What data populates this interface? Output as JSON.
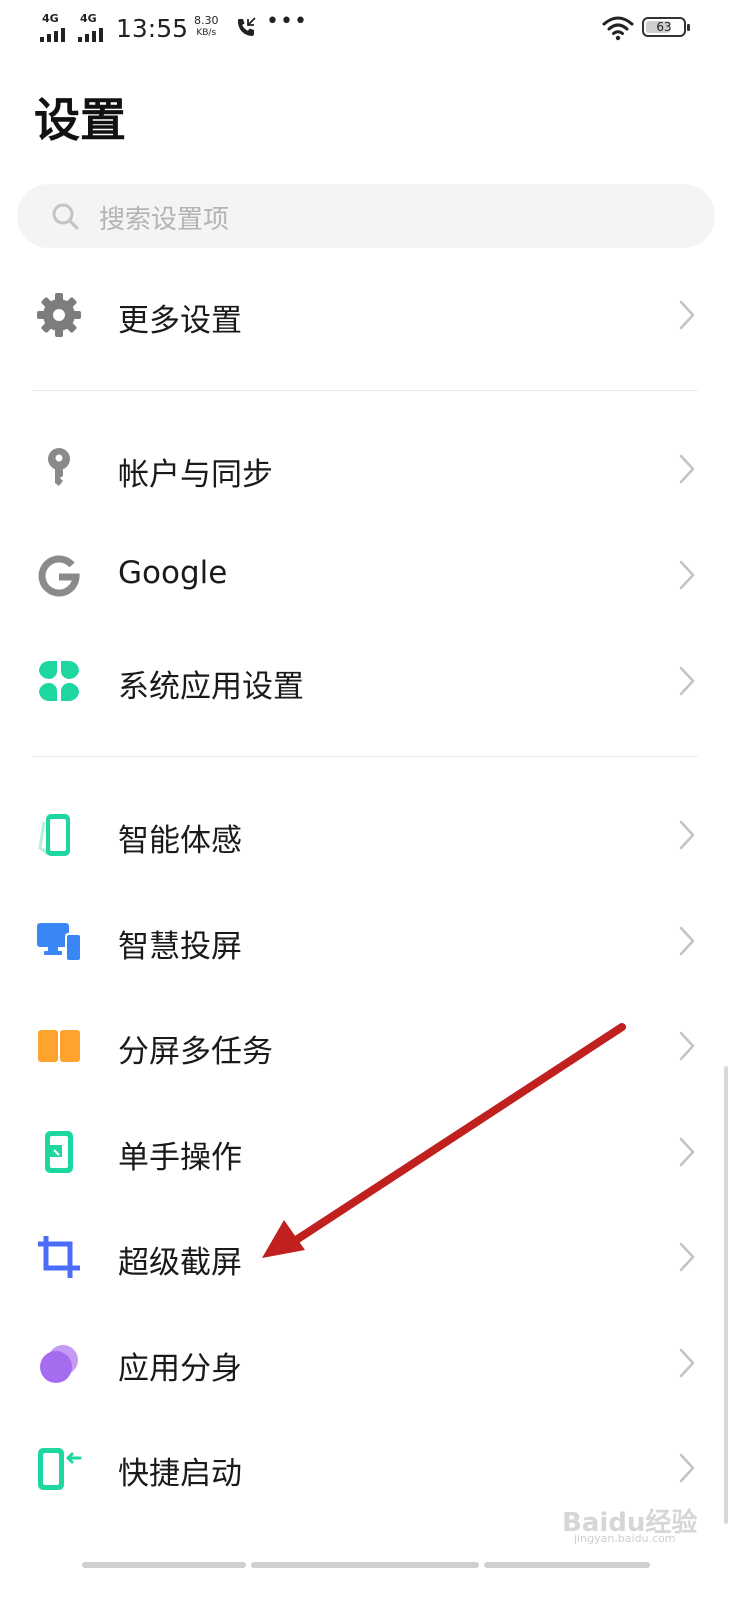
{
  "status_bar": {
    "network_1": "4G",
    "network_2": "4G",
    "time": "13:55",
    "speed_value": "8.30",
    "speed_unit": "KB/s",
    "call_icon": "phone-call-icon",
    "more_icon": "more-dots-icon",
    "wifi_icon": "wifi-icon",
    "battery_level": "63"
  },
  "page": {
    "title": "设置"
  },
  "search": {
    "placeholder": "搜索设置项",
    "icon": "search-icon"
  },
  "settings": [
    {
      "label": "更多设置",
      "icon": "gear-icon",
      "color": "#7d7d7d"
    },
    {
      "label": "帐户与同步",
      "icon": "key-icon",
      "color": "#8a8a8a"
    },
    {
      "label": "Google",
      "icon": "google-g-icon",
      "color": "#8a8a8a"
    },
    {
      "label": "系统应用设置",
      "icon": "four-petals-icon",
      "color": "#1ed6a0"
    },
    {
      "label": "智能体感",
      "icon": "phone-motion-icon",
      "color": "#1ed6a0"
    },
    {
      "label": "智慧投屏",
      "icon": "screen-cast-icon",
      "color": "#3b86f6"
    },
    {
      "label": "分屏多任务",
      "icon": "split-screen-icon",
      "color": "#ffa22e"
    },
    {
      "label": "单手操作",
      "icon": "one-hand-icon",
      "color": "#1ed6a0"
    },
    {
      "label": "超级截屏",
      "icon": "crop-icon",
      "color": "#4a6cf7"
    },
    {
      "label": "应用分身",
      "icon": "app-clone-icon",
      "color": "#a66cf0"
    },
    {
      "label": "快捷启动",
      "icon": "quick-launch-icon",
      "color": "#1ed6a0"
    }
  ],
  "annotation": {
    "arrow_color": "#c0201e"
  },
  "watermark": {
    "text": "Baidu经验",
    "sub": "jingyan.baidu.com"
  }
}
